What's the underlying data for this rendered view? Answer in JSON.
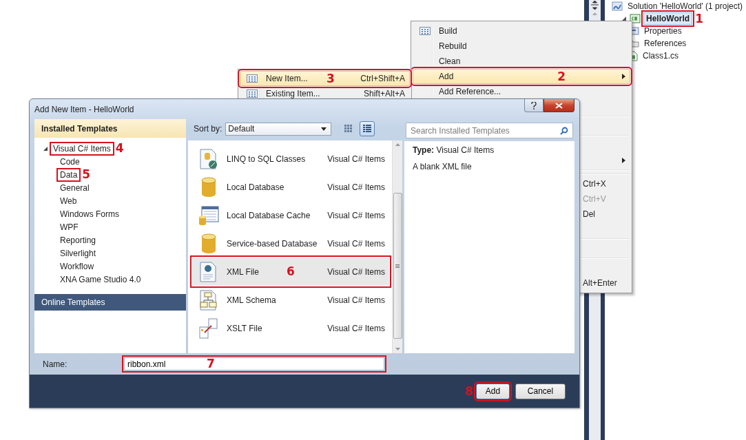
{
  "solution_explorer": {
    "tree": [
      {
        "label": "Solution 'HelloWorld' (1 project)",
        "kind": "solution",
        "selected": false,
        "children": [
          {
            "label": "HelloWorld",
            "kind": "project",
            "selected": true,
            "expanded": true,
            "callout": "1",
            "children": [
              {
                "label": "Properties",
                "kind": "properties",
                "selected": false
              },
              {
                "label": "References",
                "kind": "references",
                "selected": false
              },
              {
                "label": "Class1.cs",
                "kind": "csfile",
                "selected": false
              }
            ]
          }
        ]
      }
    ]
  },
  "context_menu": {
    "items": [
      {
        "kind": "item",
        "label": "Build",
        "icon": true,
        "selected": false
      },
      {
        "kind": "item",
        "label": "Rebuild",
        "selected": false
      },
      {
        "kind": "item",
        "label": "Clean",
        "selected": false
      },
      {
        "kind": "item",
        "label": "Add",
        "has_submenu": true,
        "selected": true,
        "callout": "2"
      },
      {
        "kind": "item",
        "label": "Add Reference...",
        "selected": false
      },
      {
        "kind": "item",
        "selected": false
      },
      {
        "kind": "separator"
      },
      {
        "kind": "item",
        "selected": false
      },
      {
        "kind": "separator"
      },
      {
        "kind": "item",
        "selected": false
      },
      {
        "kind": "item",
        "has_submenu": true,
        "selected": false
      },
      {
        "kind": "separator"
      },
      {
        "kind": "separator"
      },
      {
        "kind": "item",
        "shortcut": "Ctrl+X",
        "selected": false
      },
      {
        "kind": "item",
        "shortcut": "Ctrl+V",
        "disabled": true,
        "selected": false
      },
      {
        "kind": "item",
        "shortcut": "Del",
        "selected": false
      },
      {
        "kind": "item",
        "selected": false
      },
      {
        "kind": "separator"
      },
      {
        "kind": "item",
        "selected": false
      },
      {
        "kind": "separator"
      },
      {
        "kind": "item",
        "selected": false
      },
      {
        "kind": "item",
        "shortcut": "Alt+Enter",
        "selected": false
      }
    ]
  },
  "add_submenu": {
    "items": [
      {
        "label": "New Item...",
        "shortcut": "Ctrl+Shift+A",
        "selected": true,
        "callout": "3"
      },
      {
        "label": "Existing Item...",
        "shortcut": "Shift+Alt+A",
        "selected": false
      }
    ]
  },
  "dialog": {
    "title": "Add New Item - HelloWorld",
    "installed_header": "Installed Templates",
    "tree": [
      {
        "label": "Visual C# Items",
        "expanded": true,
        "selected": false,
        "callout": "4",
        "children": [
          {
            "label": "Code",
            "selected": false
          },
          {
            "label": "Data",
            "selected": false,
            "callout": "5"
          },
          {
            "label": "General",
            "selected": false
          },
          {
            "label": "Web",
            "selected": false
          },
          {
            "label": "Windows Forms",
            "selected": false
          },
          {
            "label": "WPF",
            "selected": false
          },
          {
            "label": "Reporting",
            "selected": false
          },
          {
            "label": "Silverlight",
            "selected": false
          },
          {
            "label": "Workflow",
            "selected": false
          },
          {
            "label": "XNA Game Studio 4.0",
            "selected": false
          }
        ]
      }
    ],
    "online_header": "Online Templates",
    "sort_label": "Sort by:",
    "sort_value": "Default",
    "view_buttons": [
      {
        "kind": "medium-icons",
        "selected": false
      },
      {
        "kind": "details",
        "selected": true
      }
    ],
    "search": {
      "placeholder": "Search Installed Templates"
    },
    "templates": [
      {
        "name": "LINQ to SQL Classes",
        "type": "Visual C# Items",
        "kind": "linq",
        "selected": false
      },
      {
        "name": "Local Database",
        "type": "Visual C# Items",
        "kind": "database",
        "selected": false
      },
      {
        "name": "Local Database Cache",
        "type": "Visual C# Items",
        "kind": "cache",
        "selected": false
      },
      {
        "name": "Service-based Database",
        "type": "Visual C# Items",
        "kind": "database",
        "selected": false
      },
      {
        "name": "XML File",
        "type": "Visual C# Items",
        "kind": "xml",
        "selected": true,
        "callout": "6"
      },
      {
        "name": "XML Schema",
        "type": "Visual C# Items",
        "kind": "schema",
        "selected": false
      },
      {
        "name": "XSLT File",
        "type": "Visual C# Items",
        "kind": "xslt",
        "selected": false
      }
    ],
    "details": {
      "type_line": "**Type:**  Visual C# Items",
      "description": "A blank XML file"
    },
    "name_label": "Name:",
    "name_value": "ribbon.xml",
    "name_callout": "7",
    "buttons": [
      {
        "label": "Add",
        "kind": "primary",
        "callout": "8"
      },
      {
        "label": "Cancel",
        "kind": "normal"
      }
    ]
  }
}
